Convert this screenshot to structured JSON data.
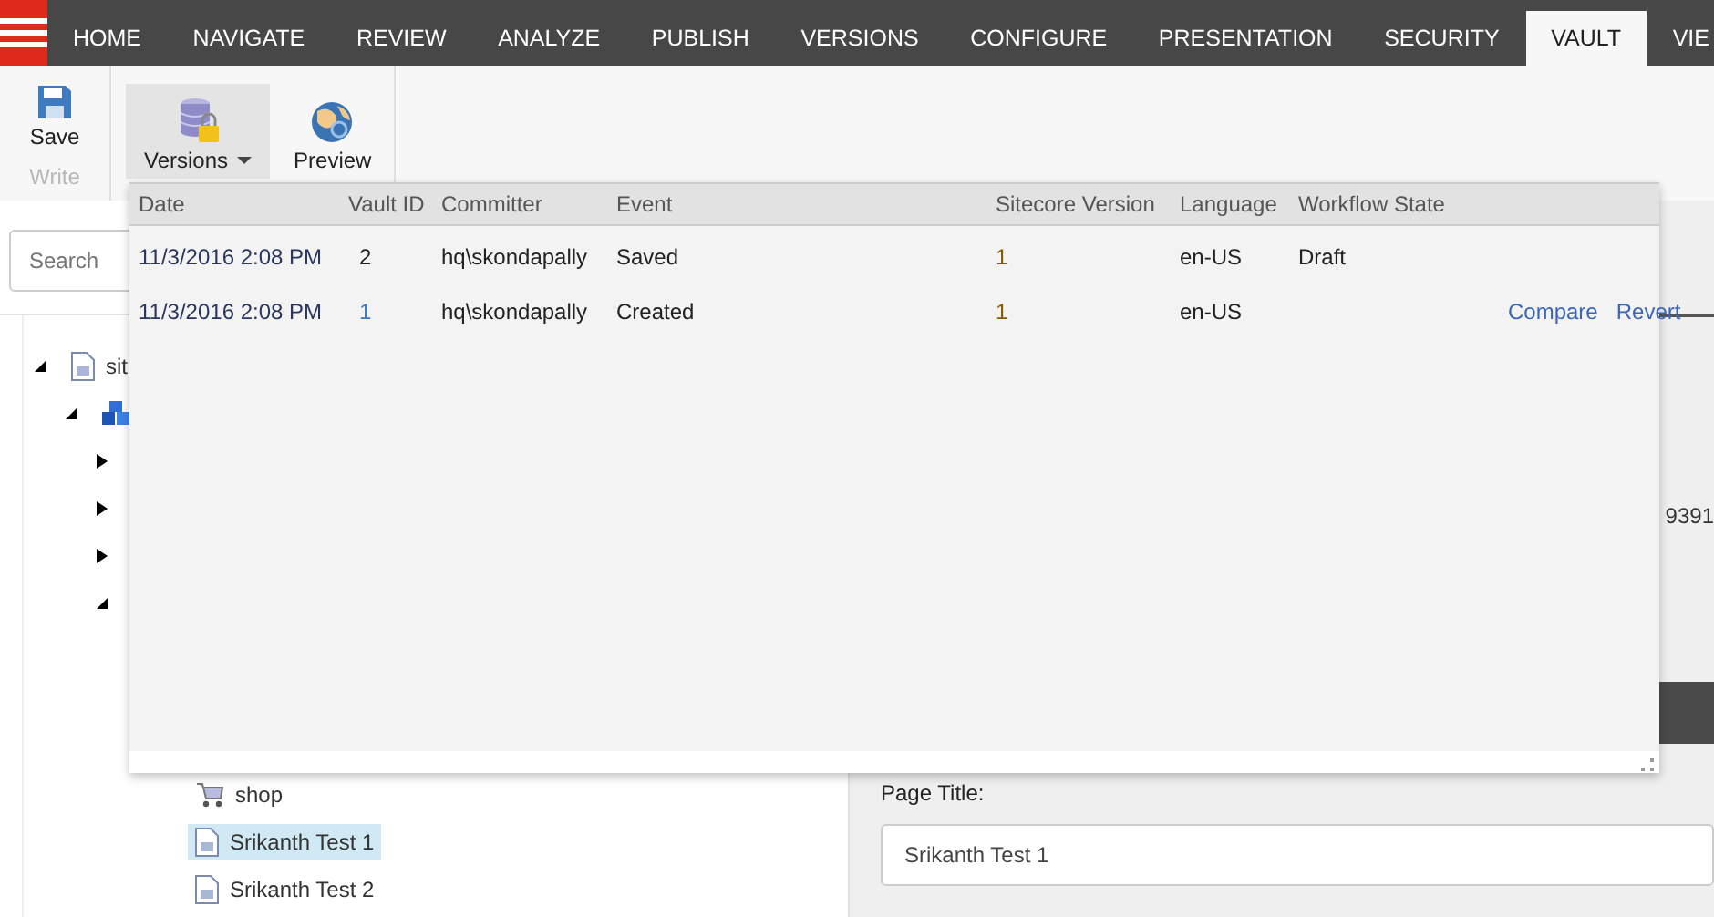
{
  "tabs": [
    {
      "label": "HOME",
      "selected": false
    },
    {
      "label": "NAVIGATE",
      "selected": false
    },
    {
      "label": "REVIEW",
      "selected": false
    },
    {
      "label": "ANALYZE",
      "selected": false
    },
    {
      "label": "PUBLISH",
      "selected": false
    },
    {
      "label": "VERSIONS",
      "selected": false
    },
    {
      "label": "CONFIGURE",
      "selected": false
    },
    {
      "label": "PRESENTATION",
      "selected": false
    },
    {
      "label": "SECURITY",
      "selected": false
    },
    {
      "label": "VAULT",
      "selected": true
    },
    {
      "label": "VIE",
      "selected": false
    }
  ],
  "ribbon": {
    "groups": [
      {
        "label": "Write",
        "buttons": [
          {
            "label": "Save",
            "kind": "save",
            "open": false
          }
        ]
      },
      {
        "buttons": [
          {
            "label": "Versions",
            "kind": "versions",
            "open": true,
            "dropdown": true
          },
          {
            "label": "Preview",
            "kind": "preview",
            "open": false
          }
        ]
      }
    ]
  },
  "search": {
    "placeholder": "Search"
  },
  "tree": [
    {
      "label": "sit",
      "kind": "page",
      "expanded": true,
      "selected": false,
      "children": [
        {
          "kind": "cubes",
          "expanded": true,
          "children": [
            {
              "expanded": false
            },
            {
              "expanded": false
            },
            {
              "expanded": false
            },
            {
              "expanded": true,
              "children": [
                {
                  "label": "shop",
                  "kind": "cart",
                  "selected": false
                },
                {
                  "label": "Srikanth Test 1",
                  "kind": "page",
                  "selected": true
                },
                {
                  "label": "Srikanth Test 2",
                  "kind": "page",
                  "selected": false
                }
              ]
            }
          ]
        }
      ]
    }
  ],
  "editor": {
    "value_fragment": "9391",
    "field_label": "Page Title:",
    "field_value": "Srikanth Test 1"
  },
  "versions_popup": {
    "columns": [
      "Date",
      "Vault ID",
      "Committer",
      "Event",
      "Sitecore Version",
      "Language",
      "Workflow State"
    ],
    "rows": [
      {
        "date": "11/3/2016 2:08 PM",
        "vault_id": "2",
        "committer": "hq\\skondapally",
        "event": "Saved",
        "sitecore_version": "1",
        "language": "en-US",
        "workflow_state": "Draft"
      },
      {
        "date": "11/3/2016 2:08 PM",
        "vault_id": "1",
        "committer": "hq\\skondapally",
        "event": "Created",
        "sitecore_version": "1",
        "language": "en-US",
        "actions": [
          "Compare",
          "Revert"
        ]
      }
    ]
  }
}
